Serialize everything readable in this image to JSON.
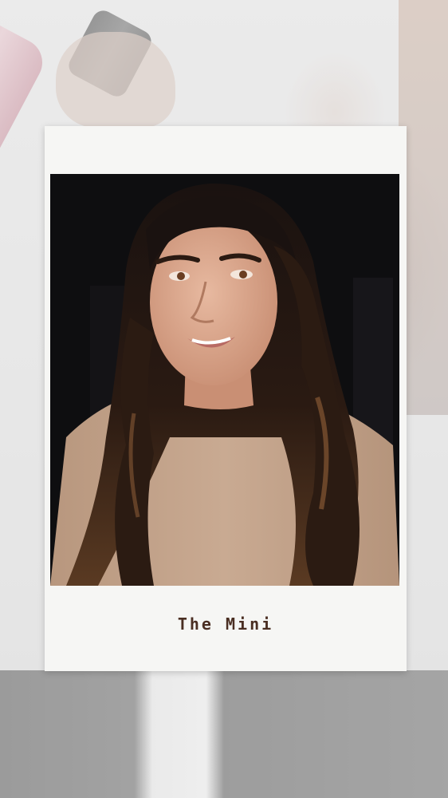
{
  "caption": "The Mini",
  "colors": {
    "card": "#f6f6f4",
    "caption_text": "#4a2e22",
    "photo_background": "#0e0e10",
    "hair_dark": "#1a1210",
    "hair_highlight": "#7a5030",
    "skin": "#d9a98f",
    "cape": "#c4a48c"
  },
  "icons": [
    "hair-spray-bottle"
  ]
}
